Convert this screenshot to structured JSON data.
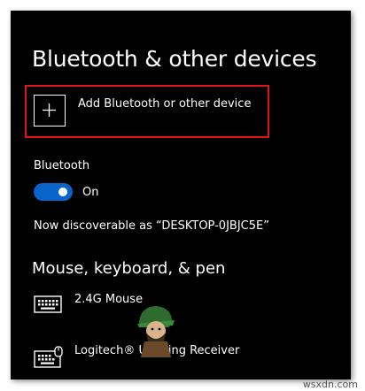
{
  "header": {
    "title": "Bluetooth & other devices"
  },
  "add_device": {
    "label": "Add Bluetooth or other device"
  },
  "bluetooth": {
    "section_label": "Bluetooth",
    "toggle_state": "On",
    "toggle_on": true,
    "discoverable_text": "Now discoverable as “DESKTOP-0JBJC5E”"
  },
  "peripherals": {
    "heading": "Mouse, keyboard, & pen",
    "devices": [
      {
        "name": "2.4G Mouse",
        "icon": "keyboard-icon"
      },
      {
        "name": "Logitech® Unifying Receiver",
        "icon": "keyboard-mouse-icon"
      }
    ]
  },
  "watermark": {
    "text": "wsxdn.com"
  },
  "colors": {
    "background": "#000000",
    "text": "#ffffff",
    "accent": "#0a63c9",
    "highlight": "#e0141b"
  }
}
